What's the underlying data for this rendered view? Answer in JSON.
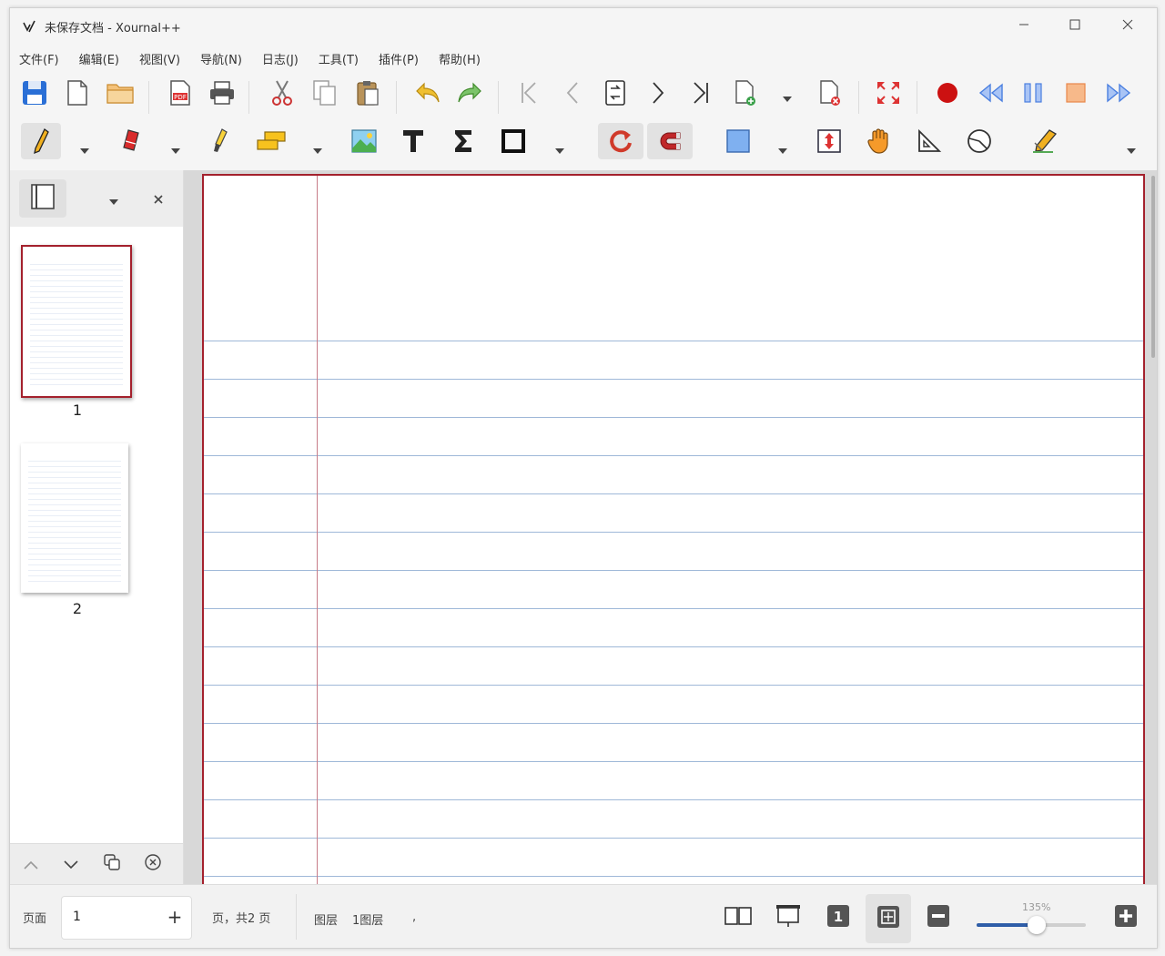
{
  "window": {
    "title": "未保存文档 - Xournal++"
  },
  "menubar": {
    "items": [
      "文件(F)",
      "编辑(E)",
      "视图(V)",
      "导航(N)",
      "日志(J)",
      "工具(T)",
      "插件(P)",
      "帮助(H)"
    ]
  },
  "toolbar1": {
    "icons": [
      "save-icon",
      "new-document-icon",
      "open-folder-icon",
      "export-pdf-icon",
      "print-icon",
      "cut-icon",
      "copy-icon",
      "paste-icon",
      "undo-icon",
      "redo-icon",
      "first-page-icon",
      "previous-page-icon",
      "goto-page-icon",
      "next-page-icon",
      "last-page-icon",
      "insert-page-icon",
      "delete-page-icon",
      "fullscreen-icon",
      "record-icon",
      "rewind-icon",
      "pause-icon",
      "stop-icon",
      "fast-forward-icon"
    ]
  },
  "toolbar2": {
    "icons": [
      "pen-icon",
      "eraser-icon",
      "highlighter-icon",
      "select-region-icon",
      "image-icon",
      "text-tool-icon",
      "latex-icon",
      "shape-icon",
      "rotation-snapping-icon",
      "grid-snapping-icon",
      "fill-color-icon",
      "vertical-space-icon",
      "hand-icon",
      "setsquare-icon",
      "compass-icon",
      "draw-config-icon"
    ]
  },
  "sidebar": {
    "pages": [
      {
        "label": "1",
        "selected": true
      },
      {
        "label": "2",
        "selected": false
      }
    ]
  },
  "statusbar": {
    "page_label": "页面",
    "page_value": "1",
    "plus": "+",
    "page_total": "页，共2 页",
    "layer_label": "图层",
    "layer_value": "1图层",
    "dot": ",",
    "zoom_label": "135%",
    "zoom_fraction": 0.55
  },
  "colors": {
    "accent": "#2f5ea8",
    "page_border": "#a4212d",
    "record": "#cc1111",
    "playback": "#4a7fe0",
    "stop": "#f0a060"
  }
}
